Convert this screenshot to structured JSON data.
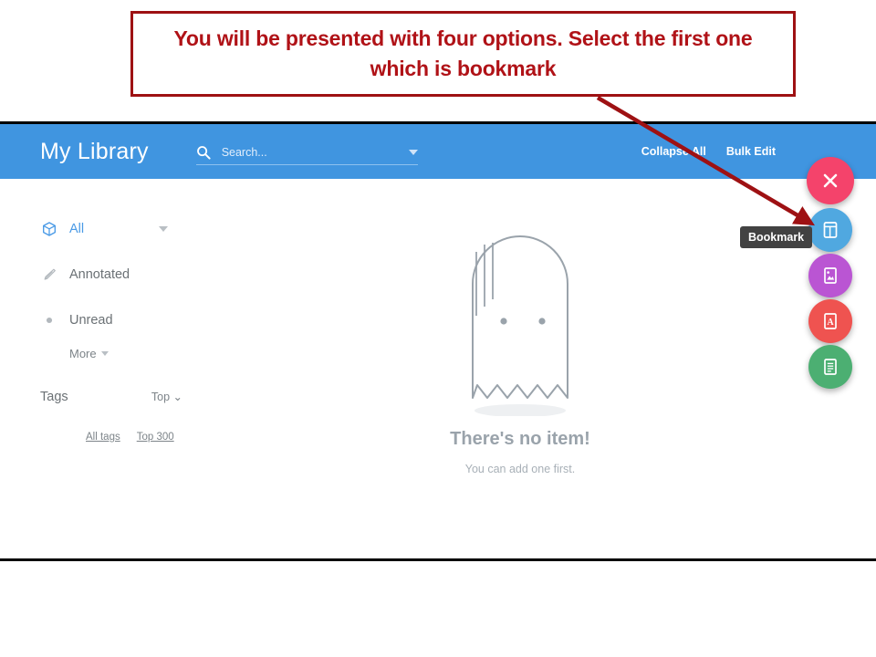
{
  "annotation": {
    "callout_text": "You will be presented with four options. Select the first one which is bookmark",
    "border_color": "#9e1113",
    "text_color": "#b01217",
    "arrow_color": "#9e1113"
  },
  "app": {
    "header": {
      "title": "My Library",
      "background_color": "#4095e0",
      "search": {
        "placeholder": "Search...",
        "value": "",
        "icon": "search-icon",
        "dropdown_icon": "chevron-down-icon"
      },
      "actions": [
        {
          "label": "Collapse All",
          "name": "collapse-all-link"
        },
        {
          "label": "Bulk Edit",
          "name": "bulk-edit-link"
        }
      ]
    },
    "sidebar": {
      "items": [
        {
          "label": "All",
          "icon": "cube-icon",
          "active": true,
          "has_caret": true
        },
        {
          "label": "Annotated",
          "icon": "pencil-icon",
          "active": false,
          "has_caret": false
        },
        {
          "label": "Unread",
          "icon": "dot-icon",
          "active": false,
          "has_caret": false
        }
      ],
      "more_label": "More",
      "more_caret_icon": "chevron-down-icon",
      "tags": {
        "title": "Tags",
        "sort_label": "Top ⌄",
        "links": [
          {
            "label": "All tags",
            "name": "all-tags-link"
          },
          {
            "label": "Top 300",
            "name": "top-300-link"
          }
        ]
      }
    },
    "empty_state": {
      "illustration": "ghost-icon",
      "title": "There's no item!",
      "subtitle": "You can add one first."
    },
    "fab_menu": {
      "close_label": "×",
      "tooltip": "Bookmark",
      "buttons": [
        {
          "name": "fab-close",
          "icon": "close-icon",
          "color": "#f4436b"
        },
        {
          "name": "fab-bookmark",
          "icon": "bookmark-icon",
          "color": "#50a8e0"
        },
        {
          "name": "fab-image",
          "icon": "image-file-icon",
          "color": "#ba55d3"
        },
        {
          "name": "fab-pdf",
          "icon": "pdf-file-icon",
          "color": "#ef5350"
        },
        {
          "name": "fab-note",
          "icon": "note-file-icon",
          "color": "#4caf72"
        }
      ]
    }
  }
}
